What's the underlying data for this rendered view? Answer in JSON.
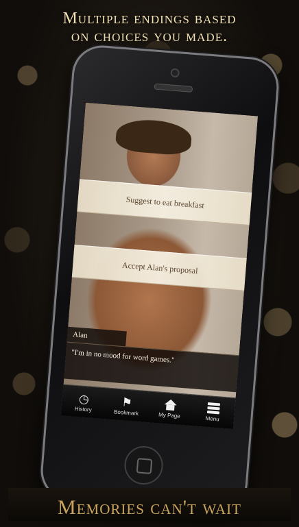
{
  "promo": {
    "headline_line1": "Multiple endings based",
    "headline_line2": "on choices you made.",
    "footer": "Memories can't wait"
  },
  "story": {
    "choices": [
      "Suggest to eat breakfast",
      "Accept Alan's proposal"
    ],
    "speaker": "Alan",
    "dialogue": "\"I'm in no mood for word games.\""
  },
  "tabbar": [
    {
      "label": "History",
      "icon": "clock-icon"
    },
    {
      "label": "Bookmark",
      "icon": "bookmark-icon"
    },
    {
      "label": "My Page",
      "icon": "home-icon"
    },
    {
      "label": "Menu",
      "icon": "menu-icon"
    }
  ]
}
